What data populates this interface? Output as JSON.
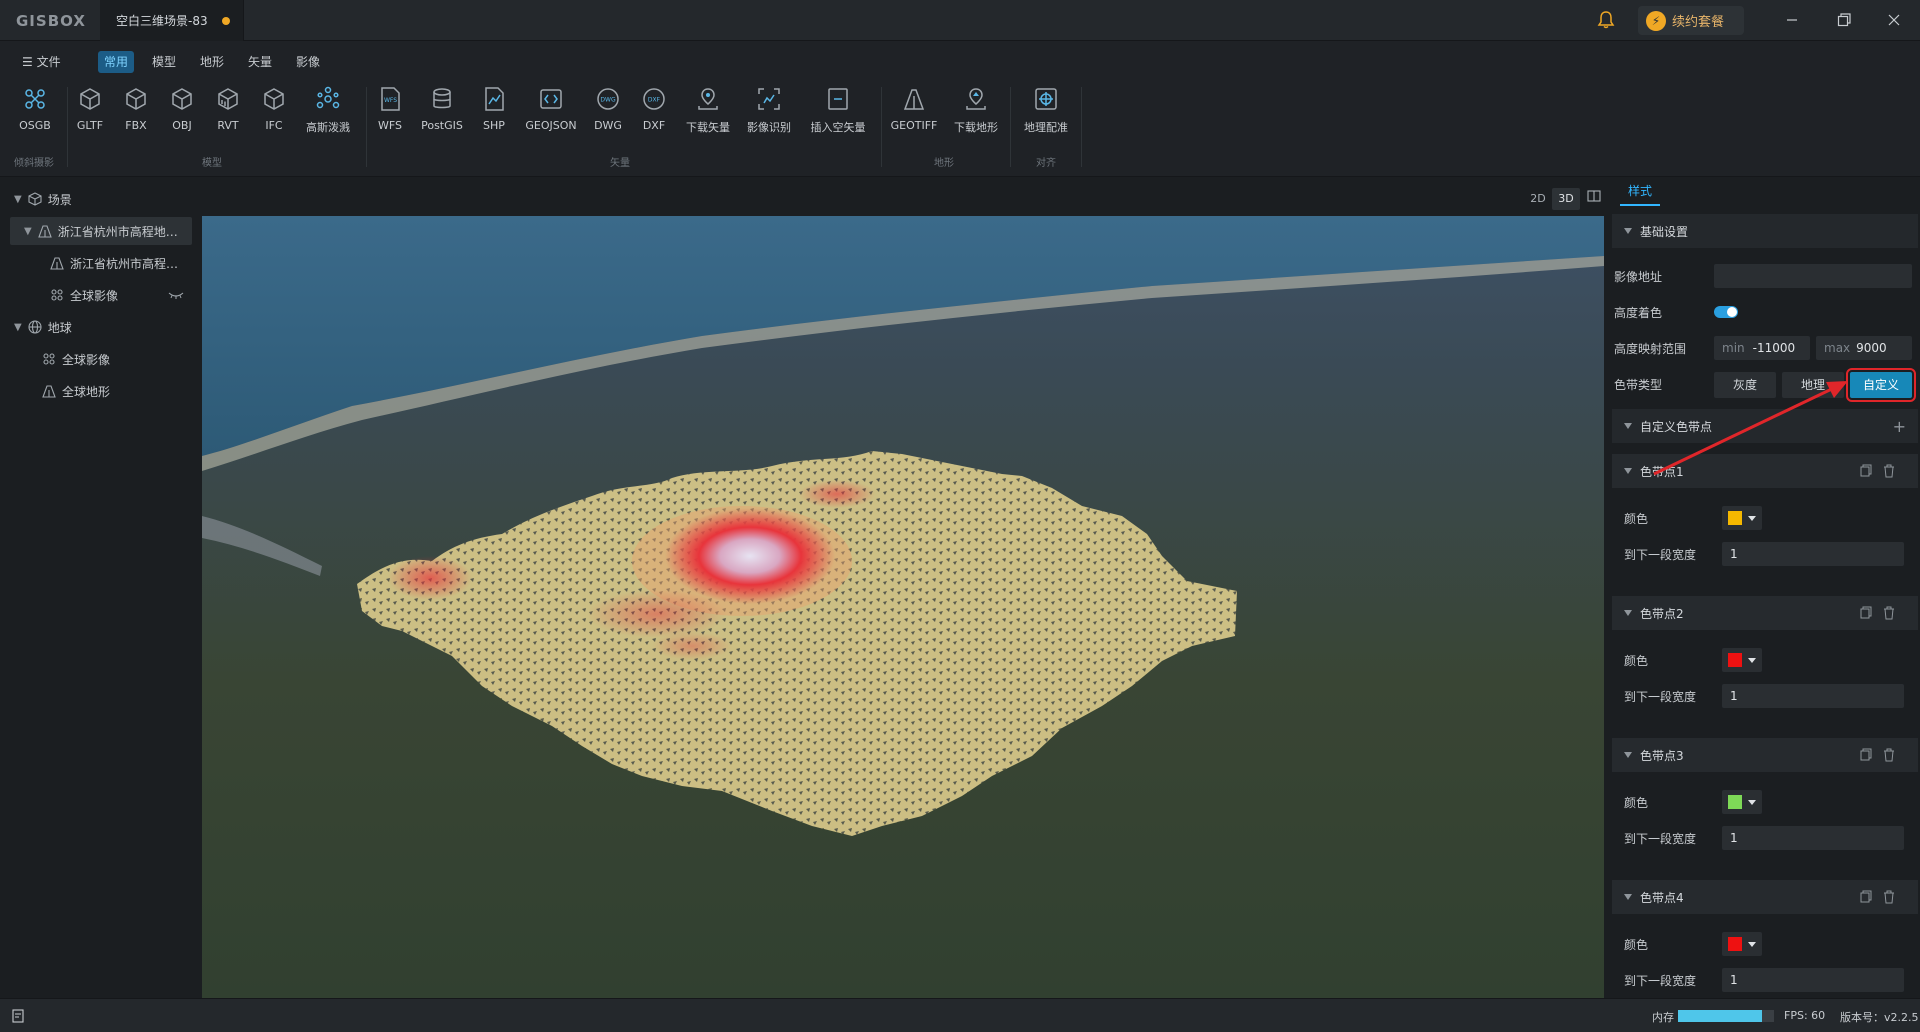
{
  "titlebar": {
    "logo": "GISBOX",
    "document_tab": "空白三维场景-83",
    "renew_label": "续约套餐",
    "colors": {
      "accent": "#32b6ff",
      "unsaved_dot": "#f0a825",
      "renew": "#e8b56a"
    }
  },
  "menu": {
    "file": "文件",
    "tabs": [
      "常用",
      "模型",
      "地形",
      "矢量",
      "影像"
    ],
    "active_tab": "常用"
  },
  "ribbon": {
    "tools": [
      "OSGB",
      "GLTF",
      "FBX",
      "OBJ",
      "RVT",
      "IFC",
      "高斯泼溅",
      "WFS",
      "PostGIS",
      "SHP",
      "GEOJSON",
      "DWG",
      "DXF",
      "下载矢量",
      "影像识别",
      "插入空矢量",
      "GEOTIFF",
      "下载地形",
      "地理配准"
    ],
    "groups": [
      "倾斜摄影",
      "模型",
      "矢量",
      "地形",
      "对齐"
    ]
  },
  "tree": {
    "scene": "场景",
    "terrain_layer": "浙江省杭州市高程地…",
    "terrain_sublayer": "浙江省杭州市高程…",
    "imagery_layer": "全球影像",
    "globe": "地球",
    "globe_imagery": "全球影像",
    "globe_terrain": "全球地形"
  },
  "view_modes": [
    "2D",
    "3D"
  ],
  "active_view_mode": "3D",
  "panel": {
    "tab": "样式",
    "basic_section": "基础设置",
    "image_url_label": "影像地址",
    "image_url_value": "",
    "height_color_label": "高度着色",
    "height_color_enabled": true,
    "range_label": "高度映射范围",
    "min_label": "min",
    "min_value": "-11000",
    "max_label": "max",
    "max_value": "9000",
    "ramp_type_label": "色带类型",
    "ramp_types": [
      "灰度",
      "地理",
      "自定义"
    ],
    "active_ramp_type": "自定义",
    "custom_section": "自定义色带点",
    "color_label": "颜色",
    "width_label": "到下一段宽度",
    "points": [
      {
        "name": "色带点1",
        "color": "#f5b800",
        "width": "1"
      },
      {
        "name": "色带点2",
        "color": "#ee1111",
        "width": "1"
      },
      {
        "name": "色带点3",
        "color": "#7ed957",
        "width": "1"
      },
      {
        "name": "色带点4",
        "color": "#ee1111",
        "width": "1"
      }
    ]
  },
  "status": {
    "memory_label": "内存",
    "memory_fraction": 0.88,
    "fps": "FPS: 60",
    "version": "版本号：v2.2.5"
  }
}
